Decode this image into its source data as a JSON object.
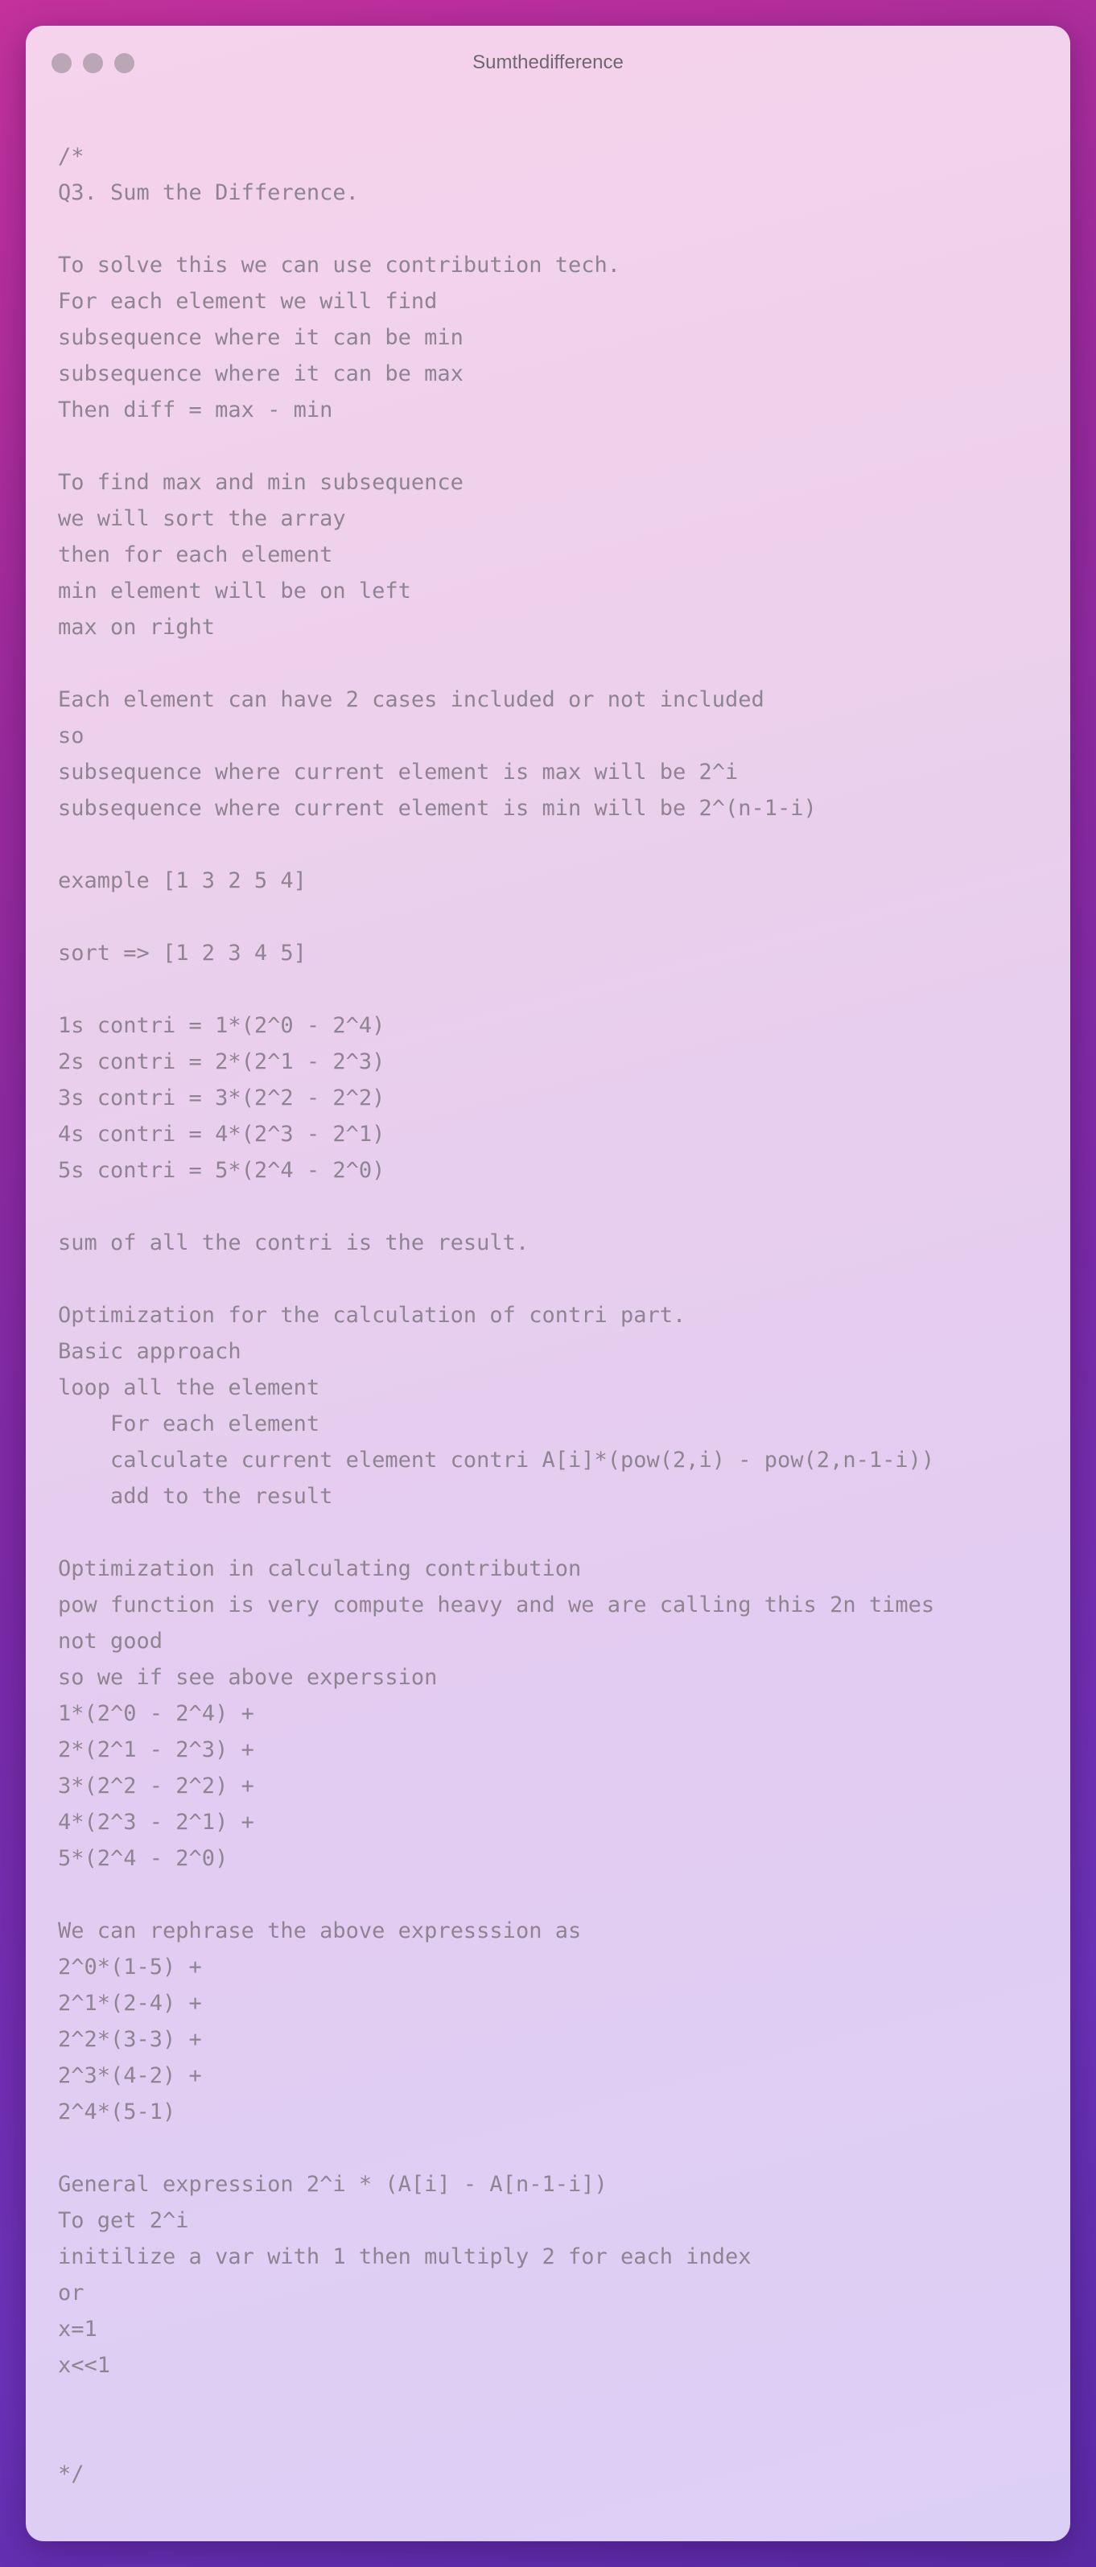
{
  "window": {
    "title": "Sumthedifference"
  },
  "editor": {
    "lines": [
      "/*",
      "Q3. Sum the Difference.",
      "",
      "To solve this we can use contribution tech.",
      "For each element we will find",
      "subsequence where it can be min",
      "subsequence where it can be max",
      "Then diff = max - min",
      "",
      "To find max and min subsequence",
      "we will sort the array",
      "then for each element",
      "min element will be on left",
      "max on right",
      "",
      "Each element can have 2 cases included or not included",
      "so",
      "subsequence where current element is max will be 2^i",
      "subsequence where current element is min will be 2^(n-1-i)",
      "",
      "example [1 3 2 5 4]",
      "",
      "sort => [1 2 3 4 5]",
      "",
      "1s contri = 1*(2^0 - 2^4)",
      "2s contri = 2*(2^1 - 2^3)",
      "3s contri = 3*(2^2 - 2^2)",
      "4s contri = 4*(2^3 - 2^1)",
      "5s contri = 5*(2^4 - 2^0)",
      "",
      "sum of all the contri is the result.",
      "",
      "Optimization for the calculation of contri part.",
      "Basic approach",
      "loop all the element",
      "    For each element",
      "    calculate current element contri A[i]*(pow(2,i) - pow(2,n-1-i))",
      "    add to the result",
      "",
      "Optimization in calculating contribution",
      "pow function is very compute heavy and we are calling this 2n times",
      "not good",
      "so we if see above experssion",
      "1*(2^0 - 2^4) +",
      "2*(2^1 - 2^3) +",
      "3*(2^2 - 2^2) +",
      "4*(2^3 - 2^1) +",
      "5*(2^4 - 2^0)",
      "",
      "We can rephrase the above expresssion as",
      "2^0*(1-5) +",
      "2^1*(2-4) +",
      "2^2*(3-3) +",
      "2^3*(4-2) +",
      "2^4*(5-1)",
      "",
      "General expression 2^i * (A[i] - A[n-1-i])",
      "To get 2^i",
      "initilize a var with 1 then multiply 2 for each index",
      "or",
      "x=1",
      "x<<1",
      "",
      "",
      "*/"
    ]
  }
}
